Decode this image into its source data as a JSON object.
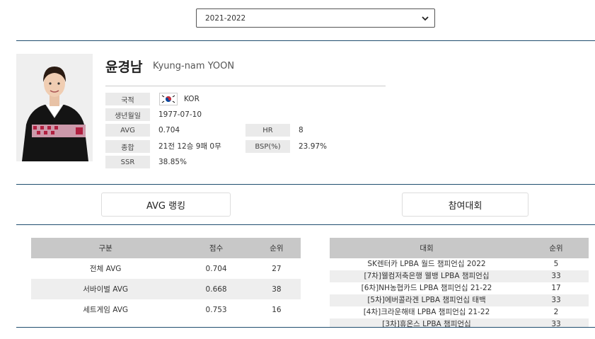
{
  "season": {
    "selected": "2021-2022"
  },
  "player": {
    "name_ko": "윤경남",
    "name_en": "Kyung-nam YOON"
  },
  "info": {
    "nationality_label": "국적",
    "nationality_value": "KOR",
    "birth_label": "생년월일",
    "birth_value": "1977-07-10",
    "avg_label": "AVG",
    "avg_value": "0.704",
    "hr_label": "HR",
    "hr_value": "8",
    "record_label": "종합",
    "record_value": "21전 12승 9패 0무",
    "bsp_label": "BSP(%)",
    "bsp_value": "23.97%",
    "ssr_label": "SSR",
    "ssr_value": "38.85%"
  },
  "buttons": {
    "avg_ranking": "AVG 랭킹",
    "tournaments": "참여대회"
  },
  "ranking_table": {
    "headers": [
      "구분",
      "점수",
      "순위"
    ],
    "rows": [
      [
        "전체 AVG",
        "0.704",
        "27"
      ],
      [
        "서바이벌 AVG",
        "0.668",
        "38"
      ],
      [
        "세트게임 AVG",
        "0.753",
        "16"
      ]
    ]
  },
  "tournament_table": {
    "headers": [
      "대회",
      "순위"
    ],
    "rows": [
      [
        "SK렌터카 LPBA 월드 챔피언십 2022",
        "5"
      ],
      [
        "[7차]웰컴저축은행 웰뱅 LPBA 챔피언십",
        "33"
      ],
      [
        "[6차]NH농협카드 LPBA 챔피언십 21-22",
        "17"
      ],
      [
        "[5차]에버콜라겐 LPBA 챔피언십 태백",
        "33"
      ],
      [
        "[4차]크라운해태 LPBA 챔피언십 21-22",
        "2"
      ],
      [
        "[3차]휴온스 LPBA 챔피언십",
        "33"
      ]
    ]
  }
}
